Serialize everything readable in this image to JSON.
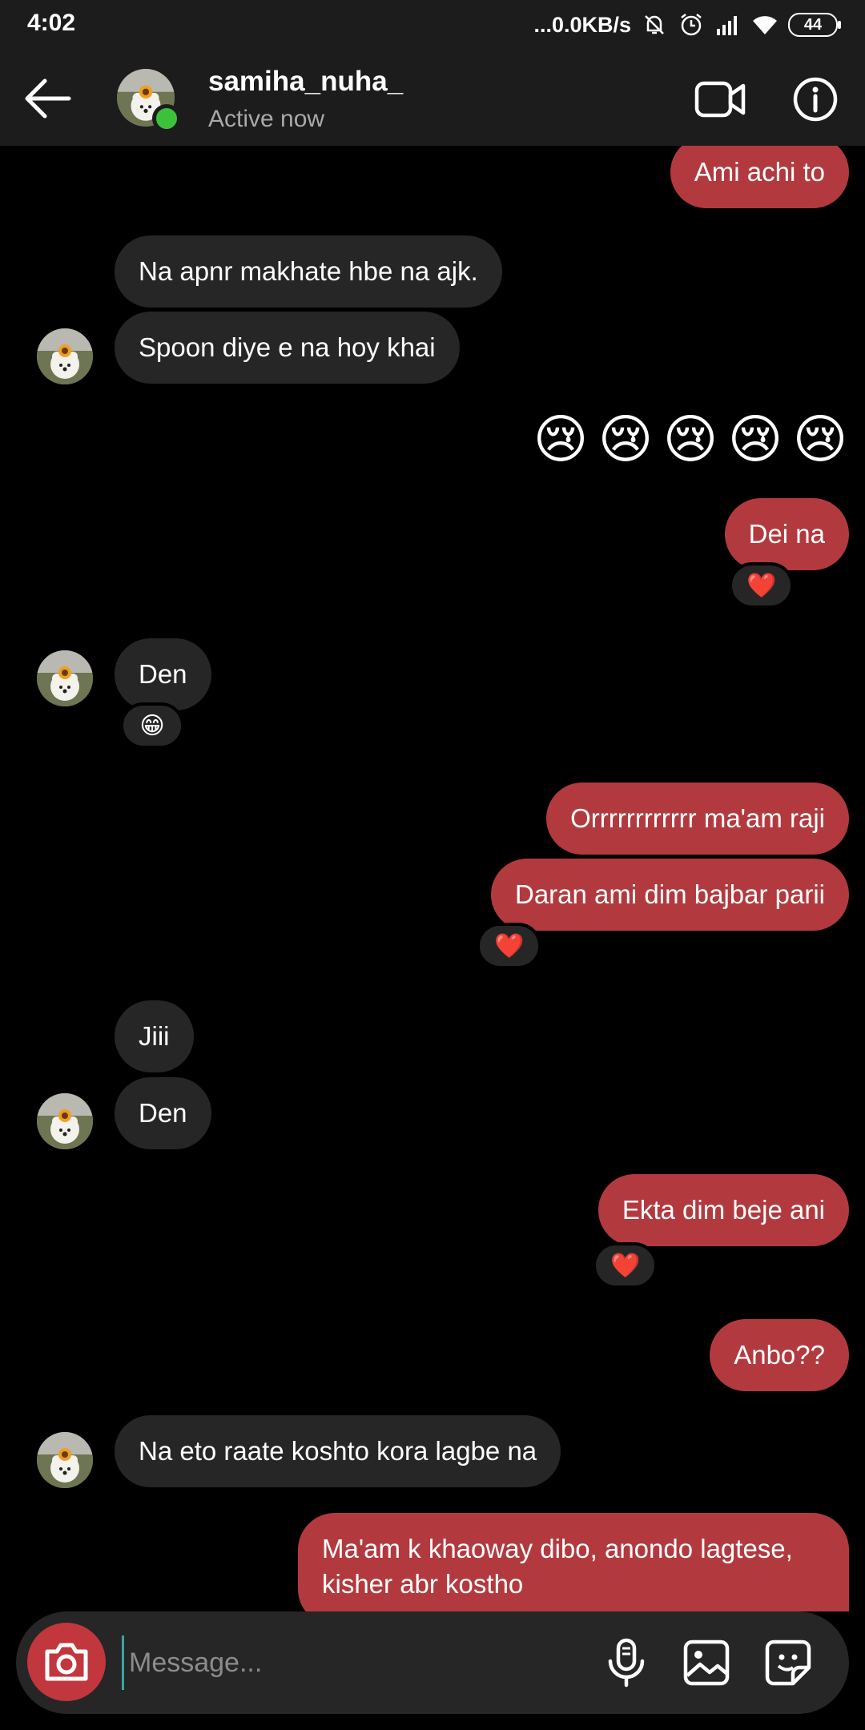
{
  "status_bar": {
    "time": "4:02",
    "network_speed": "...0.0KB/s",
    "battery": "44",
    "icons": [
      "mute-bell-icon",
      "alarm-icon",
      "signal-icon",
      "wifi-icon",
      "battery-icon"
    ]
  },
  "header": {
    "username": "samiha_nuha_",
    "status": "Active now",
    "icons": [
      "back-arrow-icon",
      "video-call-icon",
      "info-icon"
    ],
    "online_color": "#3cc13b"
  },
  "messages": [
    {
      "side": "out",
      "text": "Ami achi to"
    },
    {
      "side": "in",
      "text": "Na apnr makhate hbe na ajk."
    },
    {
      "side": "in",
      "text": "Spoon diye e na hoy khai"
    },
    {
      "side": "out",
      "emoji": "😢😢😢😢😢"
    },
    {
      "side": "out",
      "text": "Dei na",
      "reaction": "❤️"
    },
    {
      "side": "in",
      "text": "Den",
      "reaction": "😁"
    },
    {
      "side": "out",
      "text": "Orrrrrrrrrrrr ma'am raji"
    },
    {
      "side": "out",
      "text": "Daran ami dim bajbar parii",
      "reaction": "❤️"
    },
    {
      "side": "in",
      "text": "Jiii"
    },
    {
      "side": "in",
      "text": "Den"
    },
    {
      "side": "out",
      "text": "Ekta dim beje ani",
      "reaction": "❤️"
    },
    {
      "side": "out",
      "text": "Anbo??"
    },
    {
      "side": "in",
      "text": "Na eto raate koshto kora lagbe na"
    },
    {
      "side": "out",
      "text": "Ma'am k khaoway dibo, anondo lagtese, kisher abr kostho"
    }
  ],
  "composer": {
    "placeholder": "Message...",
    "icons": [
      "camera-icon",
      "microphone-icon",
      "gallery-icon",
      "sticker-icon"
    ]
  },
  "colors": {
    "outgoing_bubble": "#b23a3f",
    "incoming_bubble": "#262626",
    "background": "#000000",
    "camera_button": "#c1373d"
  }
}
